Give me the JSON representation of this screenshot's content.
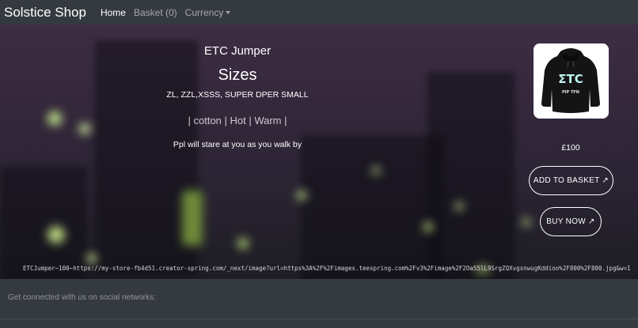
{
  "navbar": {
    "brand": "Solstice Shop",
    "home_label": "Home",
    "basket_label": "Basket (0)",
    "currency_label": "Currency"
  },
  "product": {
    "name": "ETC Jumper",
    "sizes_heading": "Sizes",
    "sizes": "ZL, ZZL,XSSS, SUPER DPER SMALL",
    "tags": "| cotton | Hot | Warm |",
    "description": "Ppl will stare at you as you walk by",
    "price": "£100",
    "image_logo": "ΣTC",
    "image_sublabel": "PIP TFN",
    "meta": "ETCJumper~100~https://my-store-fb4d51.creator-spring.com/_next/image?url=https%3A%2F%2Fimages.teespring.com%2Fv3%2Fimage%2F2Oa55lL9SrgZQXvgsnwugKddioo%2F800%2F800.jpg&w=1"
  },
  "actions": {
    "add_to_basket": "ADD TO BASKET ↗",
    "buy_now": "BUY NOW ↗"
  },
  "footer": {
    "text": "Get connected with us on social networks:"
  },
  "colors": {
    "navbar_bg": "#343a40",
    "hero_tint": "#3d2d44",
    "footer_bg": "#343a40"
  }
}
